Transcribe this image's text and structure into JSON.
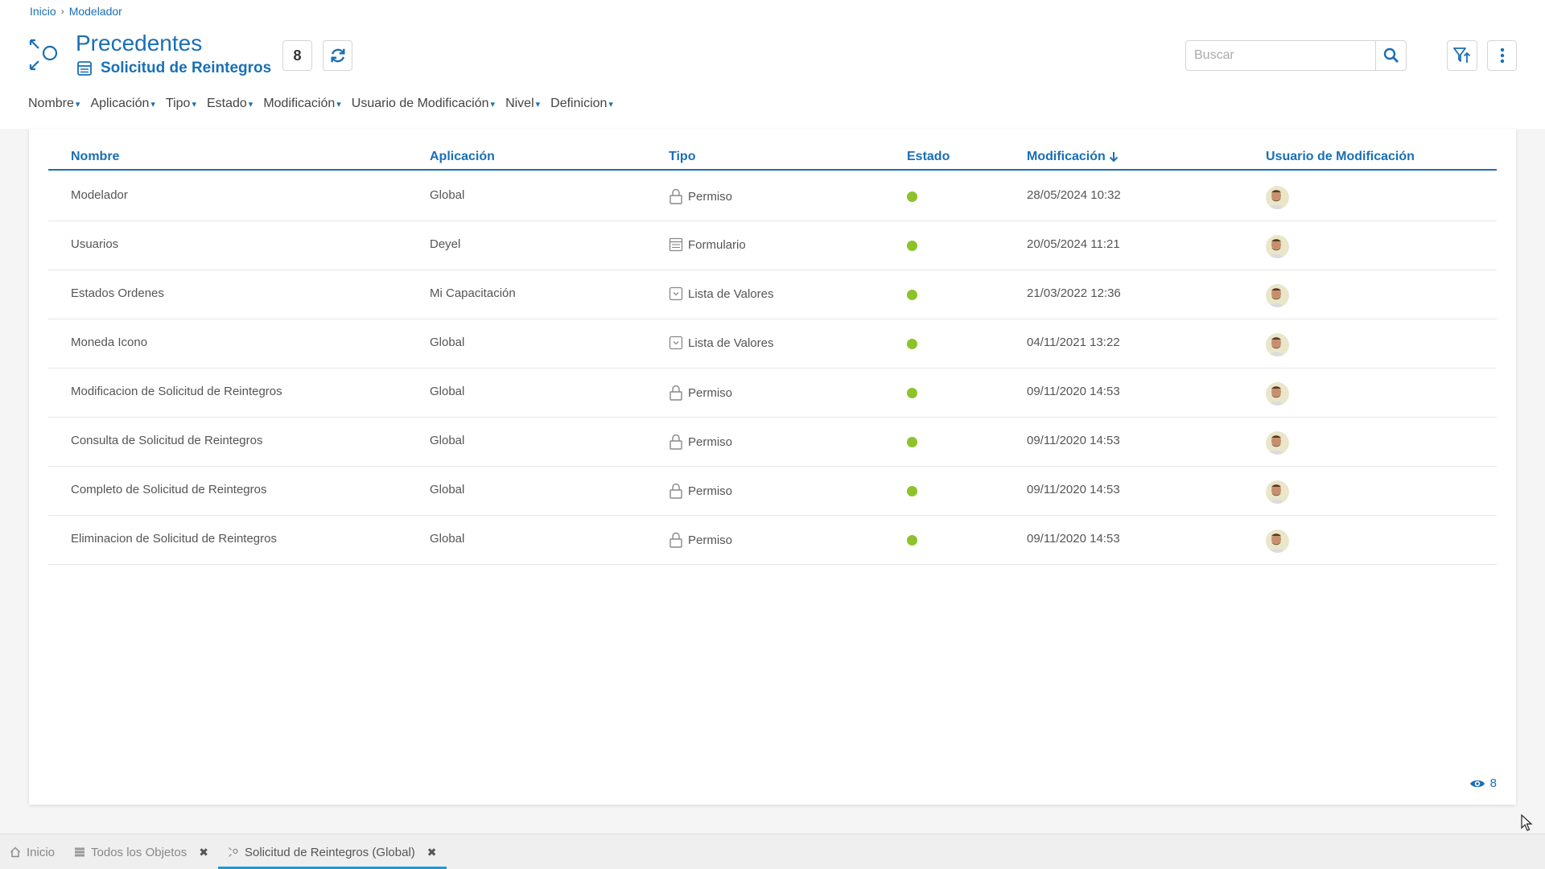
{
  "breadcrumb": {
    "home": "Inicio",
    "current": "Modelador"
  },
  "header": {
    "title": "Precedentes",
    "subtitle": "Solicitud de Reintegros",
    "count": "8",
    "search_placeholder": "Buscar"
  },
  "filters": [
    "Nombre",
    "Aplicación",
    "Tipo",
    "Estado",
    "Modificación",
    "Usuario de Modificación",
    "Nivel",
    "Definicion"
  ],
  "table": {
    "columns": [
      "Nombre",
      "Aplicación",
      "Tipo",
      "Estado",
      "Modificación",
      "Usuario de Modificación"
    ],
    "sort_column": "Modificación",
    "rows": [
      {
        "nombre": "Modelador",
        "aplicacion": "Global",
        "tipo": "Permiso",
        "tipo_icon": "lock-icon",
        "fecha": "28/05/2024 10:32"
      },
      {
        "nombre": "Usuarios",
        "aplicacion": "Deyel",
        "tipo": "Formulario",
        "tipo_icon": "form-icon",
        "fecha": "20/05/2024 11:21"
      },
      {
        "nombre": "Estados Ordenes",
        "aplicacion": "Mi Capacitación",
        "tipo": "Lista de Valores",
        "tipo_icon": "list-icon",
        "fecha": "21/03/2022 12:36"
      },
      {
        "nombre": "Moneda Icono",
        "aplicacion": "Global",
        "tipo": "Lista de Valores",
        "tipo_icon": "list-icon",
        "fecha": "04/11/2021 13:22"
      },
      {
        "nombre": "Modificacion de Solicitud de Reintegros",
        "aplicacion": "Global",
        "tipo": "Permiso",
        "tipo_icon": "lock-icon",
        "fecha": "09/11/2020 14:53"
      },
      {
        "nombre": "Consulta de Solicitud de Reintegros",
        "aplicacion": "Global",
        "tipo": "Permiso",
        "tipo_icon": "lock-icon",
        "fecha": "09/11/2020 14:53"
      },
      {
        "nombre": "Completo de Solicitud de Reintegros",
        "aplicacion": "Global",
        "tipo": "Permiso",
        "tipo_icon": "lock-icon",
        "fecha": "09/11/2020 14:53"
      },
      {
        "nombre": "Eliminacion de Solicitud de Reintegros",
        "aplicacion": "Global",
        "tipo": "Permiso",
        "tipo_icon": "lock-icon",
        "fecha": "09/11/2020 14:53"
      }
    ]
  },
  "footer": {
    "views": "8"
  },
  "tabs": [
    {
      "label": "Inicio",
      "icon": "home-icon",
      "closable": false,
      "active": false
    },
    {
      "label": "Todos los Objetos",
      "icon": "list-icon",
      "closable": true,
      "active": false
    },
    {
      "label": "Solicitud de Reintegros (Global)",
      "icon": "model-icon",
      "closable": true,
      "active": true
    }
  ],
  "colors": {
    "accent": "#1a6fb5",
    "status_active": "#8dc22a",
    "tab_underline": "#1a9ad6"
  }
}
